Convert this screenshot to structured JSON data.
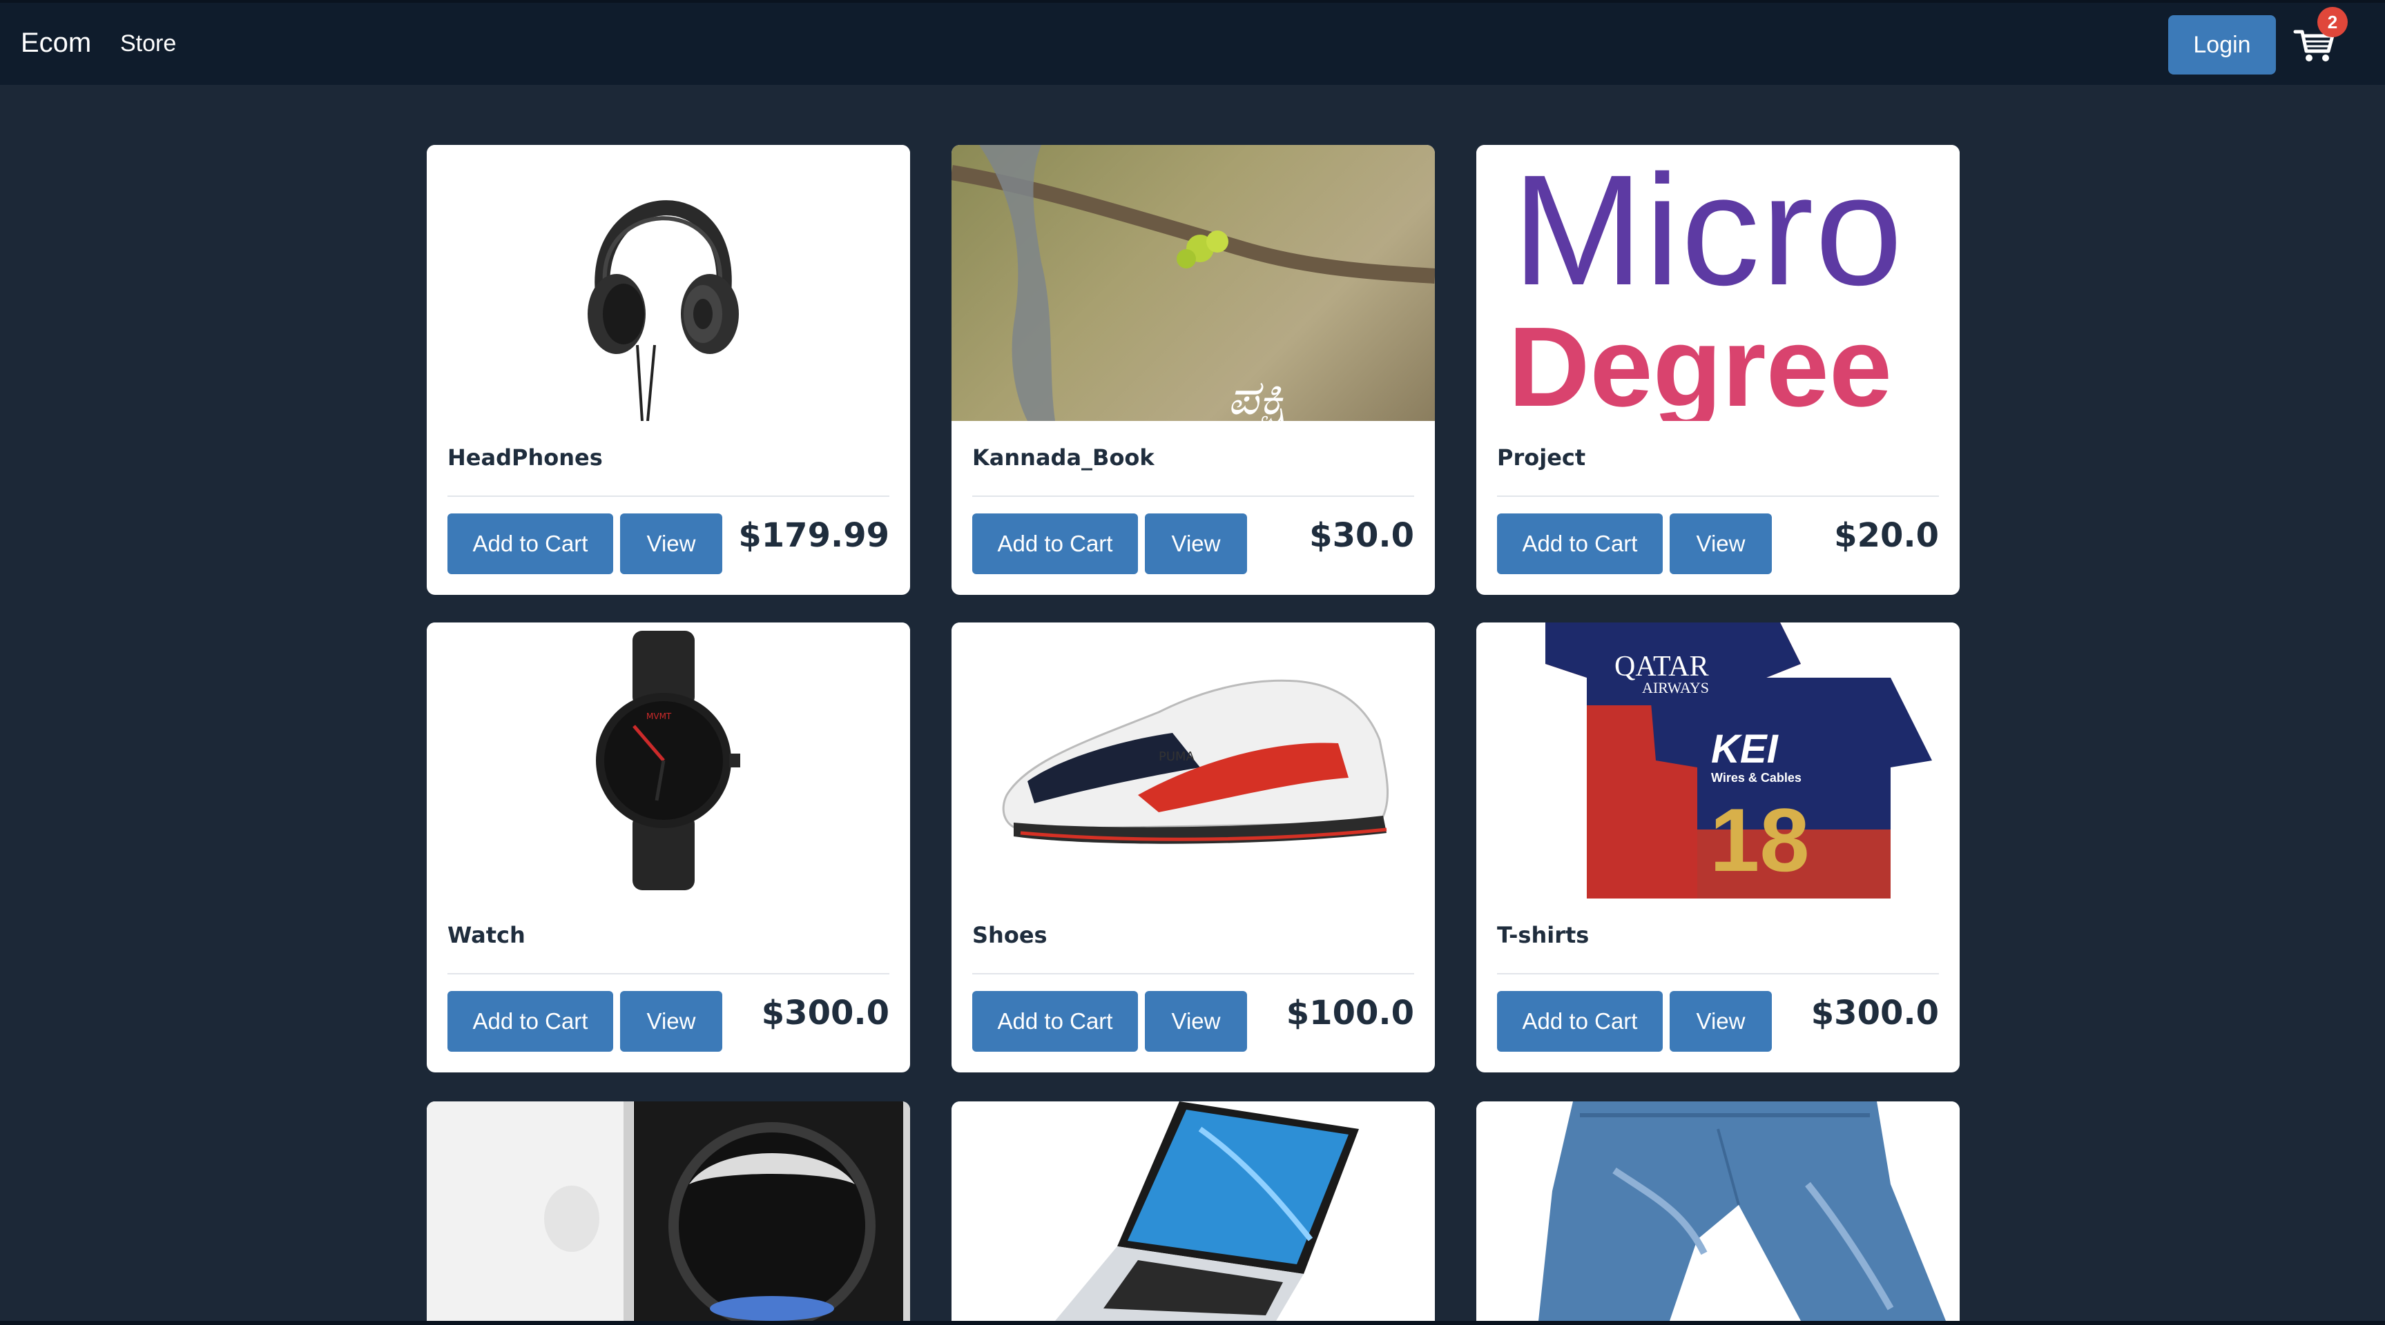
{
  "navbar": {
    "brand": "Ecom",
    "store_link": "Store",
    "login_label": "Login",
    "cart_count": "2",
    "cart_icon": "shopping-cart-icon"
  },
  "products": [
    {
      "title": "HeadPhones",
      "price": "$179.99",
      "add_label": "Add to Cart",
      "view_label": "View",
      "image": "headphones-image"
    },
    {
      "title": "Kannada_Book",
      "price": "$30.0",
      "add_label": "Add to Cart",
      "view_label": "View",
      "image": "bird-book-cover-image"
    },
    {
      "title": "Project",
      "price": "$20.0",
      "add_label": "Add to Cart",
      "view_label": "View",
      "image": "micro-degree-logo-image",
      "image_text": [
        "Micro",
        "Degree"
      ]
    },
    {
      "title": "Watch",
      "price": "$300.0",
      "add_label": "Add to Cart",
      "view_label": "View",
      "image": "wristwatch-image"
    },
    {
      "title": "Shoes",
      "price": "$100.0",
      "add_label": "Add to Cart",
      "view_label": "View",
      "image": "sneaker-image"
    },
    {
      "title": "T-shirts",
      "price": "$300.0",
      "add_label": "Add to Cart",
      "view_label": "View",
      "image": "cricket-jersey-image",
      "image_text": [
        "QATAR",
        "AIRWAYS",
        "KEI",
        "Wires & Cables",
        "18"
      ]
    },
    {
      "image": "smartphone-image"
    },
    {
      "image": "laptop-image"
    },
    {
      "image": "jeans-image"
    }
  ],
  "colors": {
    "background": "#1c2837",
    "navbar": "#0f1c2c",
    "button": "#3c7ab8",
    "badge": "#e0473a",
    "text_dark": "#1f2d3d"
  }
}
